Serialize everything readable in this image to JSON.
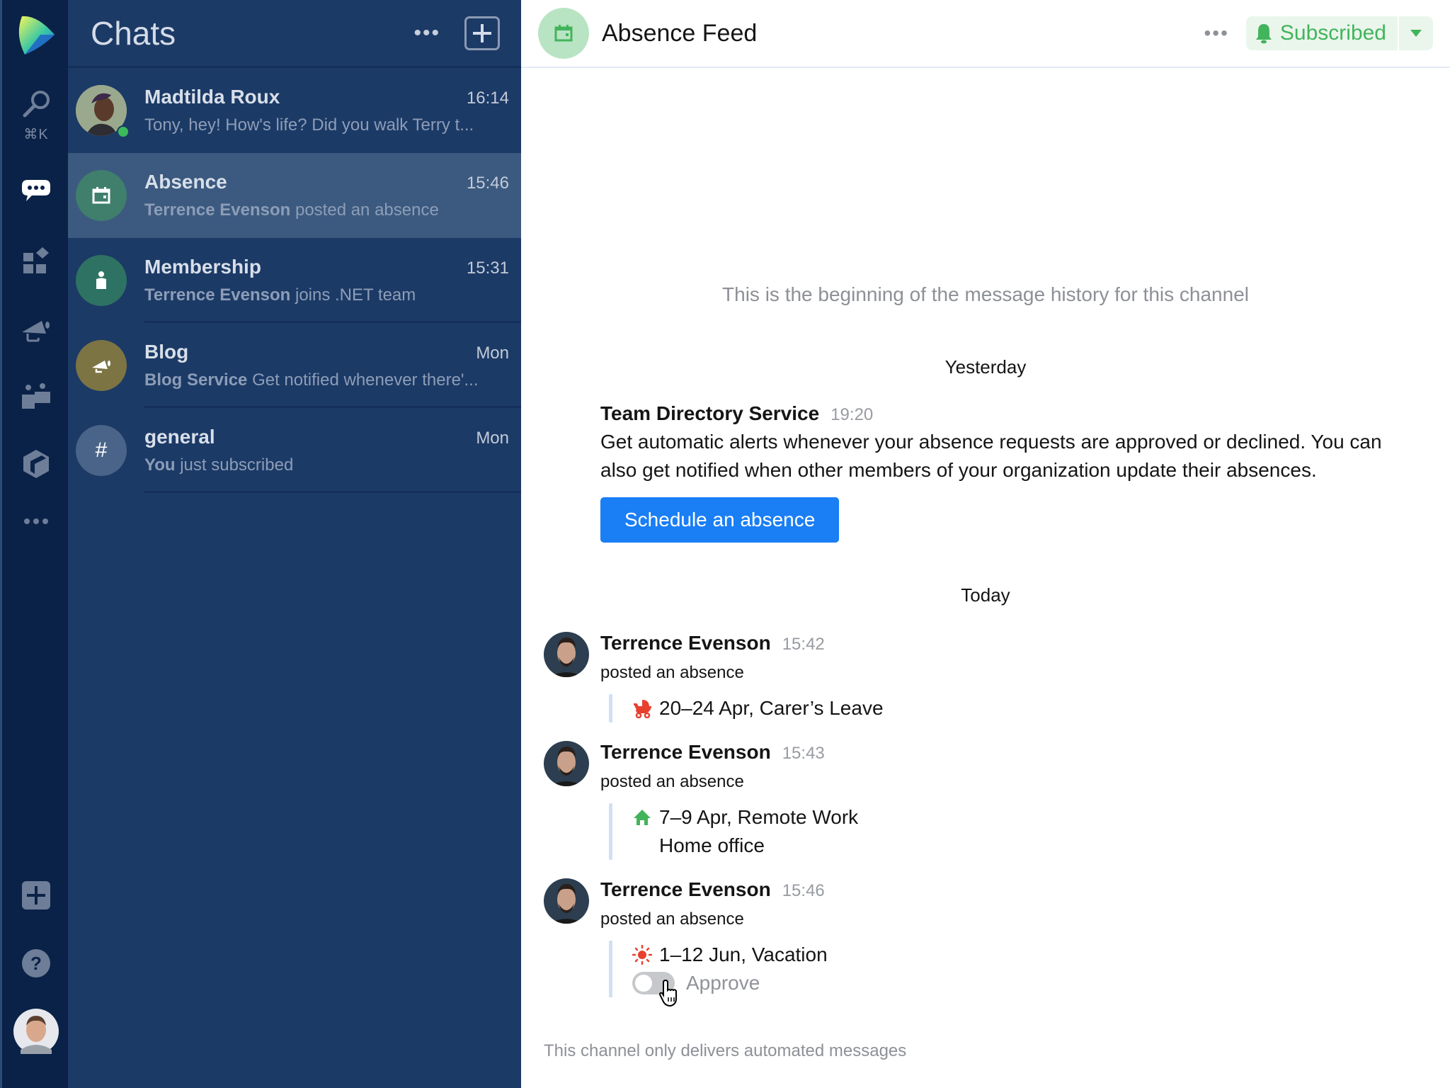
{
  "rail": {
    "logo": "app-logo",
    "items": [
      {
        "name": "search",
        "icon": "search-icon",
        "shortcut": "⌘K"
      },
      {
        "name": "chats",
        "icon": "chat-bubble-icon",
        "active": true
      },
      {
        "name": "apps",
        "icon": "apps-icon"
      },
      {
        "name": "announcements",
        "icon": "megaphone-icon"
      },
      {
        "name": "teams",
        "icon": "people-icon"
      },
      {
        "name": "packages",
        "icon": "package-icon"
      },
      {
        "name": "more",
        "icon": "more-icon"
      }
    ],
    "bottom": [
      {
        "name": "add",
        "icon": "plus-square-icon"
      },
      {
        "name": "help",
        "icon": "help-icon",
        "glyph": "?"
      },
      {
        "name": "profile",
        "icon": "user-avatar"
      }
    ]
  },
  "chats": {
    "title": "Chats",
    "more_glyph": "•••",
    "items": [
      {
        "name": "Madtilda Roux",
        "time": "16:14",
        "preview_bold": "",
        "preview": "Tony, hey! How's life? Did you walk Terry t...",
        "online": true,
        "avatar": "photo"
      },
      {
        "name": "Absence",
        "time": "15:46",
        "preview_bold": "Terrence Evenson",
        "preview": " posted an absence",
        "active": true,
        "icon": "calendar-icon",
        "color": "#3f7f6b"
      },
      {
        "name": "Membership",
        "time": "15:31",
        "preview_bold": "Terrence Evenson",
        "preview": " joins .NET team",
        "icon": "person-icon",
        "color": "#2e7263"
      },
      {
        "name": "Blog",
        "time": "Mon",
        "preview_bold": "Blog Service",
        "preview": " Get notified whenever there'...",
        "icon": "megaphone-icon",
        "color": "#7d7444"
      },
      {
        "name": "general",
        "time": "Mon",
        "preview_bold": "You",
        "preview": " just subscribed",
        "icon": "hash-icon",
        "glyph": "#",
        "color": "#4a6489"
      }
    ]
  },
  "channel": {
    "title": "Absence Feed",
    "more_glyph": "•••",
    "subscribe_label": "Subscribed",
    "accent": "#42b45c",
    "history_begin": "This is the beginning of the message history for this channel",
    "days": [
      "Yesterday",
      "Today"
    ],
    "service_message": {
      "author": "Team Directory Service",
      "time": "19:20",
      "text": "Get automatic alerts whenever your absence requests are approved or declined. You can also get notified when other members of your organization update their absences.",
      "button": "Schedule an absence"
    },
    "messages": [
      {
        "author": "Terrence Evenson",
        "time": "15:42",
        "action": "posted an absence",
        "absence": "20–24 Apr, Carer’s Leave",
        "icon": "stroller-icon",
        "icon_color": "#e8402e"
      },
      {
        "author": "Terrence Evenson",
        "time": "15:43",
        "action": "posted an absence",
        "absence": "7–9 Apr, Remote Work",
        "note": "Home office",
        "icon": "home-icon",
        "icon_color": "#42b45c"
      },
      {
        "author": "Terrence Evenson",
        "time": "15:46",
        "action": "posted an absence",
        "absence": "1–12 Jun, Vacation",
        "icon": "sun-icon",
        "icon_color": "#e8402e",
        "approve_label": "Approve",
        "approve_on": false
      }
    ],
    "footer": "This channel only delivers automated messages"
  }
}
